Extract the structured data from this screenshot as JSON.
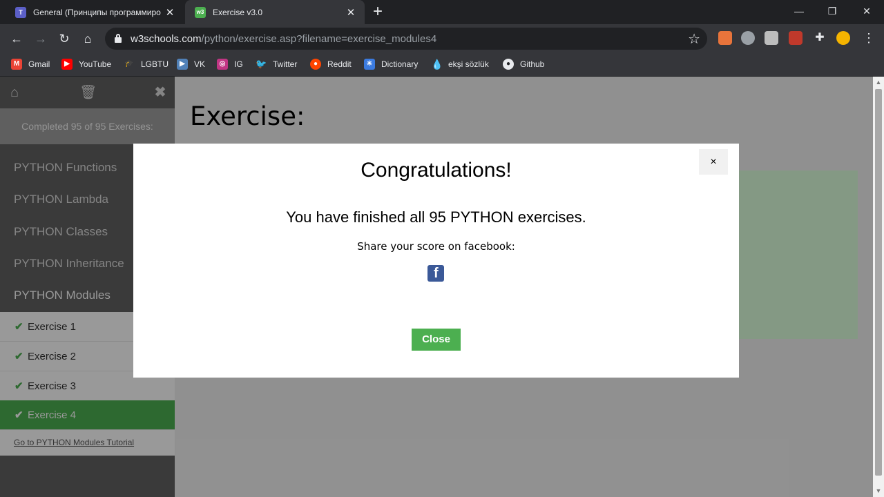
{
  "browser": {
    "tabs": [
      {
        "title": "General (Принципы программиро",
        "icon": "teams-icon"
      },
      {
        "title": "Exercise v3.0",
        "icon": "w3schools-icon"
      }
    ],
    "url_host": "w3schools.com",
    "url_path": "/python/exercise.asp?filename=exercise_modules4",
    "bookmarks": [
      "Gmail",
      "YouTube",
      "LGBTU",
      "VK",
      "IG",
      "Twitter",
      "Reddit",
      "Dictionary",
      "ekşi sözlük",
      "Github"
    ]
  },
  "sidebar": {
    "completed": "Completed 95 of 95 Exercises:",
    "categories": [
      "PYTHON Functions",
      "PYTHON Lambda",
      "PYTHON Classes",
      "PYTHON Inheritance",
      "PYTHON Modules"
    ],
    "exercises": [
      "Exercise 1",
      "Exercise 2",
      "Exercise 3",
      "Exercise 4"
    ],
    "tutorial_link": "Go to PYTHON Modules Tutorial"
  },
  "main": {
    "title": "Exercise:"
  },
  "modal": {
    "close_x": "×",
    "title": "Congratulations!",
    "message": "You have finished all 95 PYTHON exercises.",
    "share_text": "Share your score on facebook:",
    "close_button": "Close"
  },
  "colors": {
    "accent": "#4caf50",
    "facebook": "#3b5998"
  }
}
